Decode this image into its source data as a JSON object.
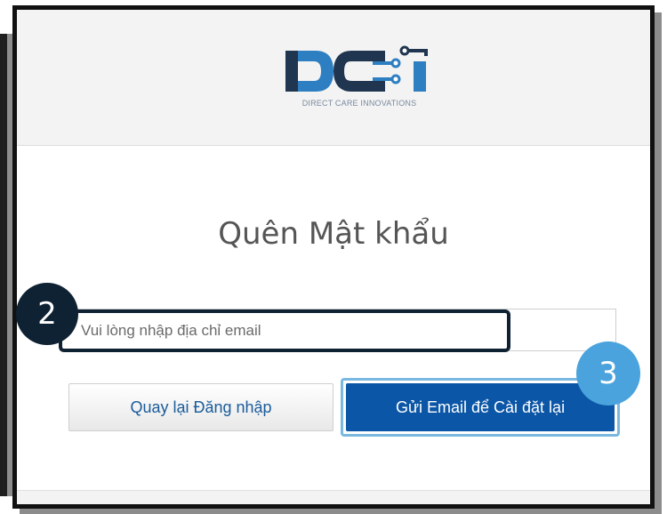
{
  "brand": {
    "logo_text": "DIRECT CARE INNOVATIONS",
    "colors": {
      "primary": "#0b56a6",
      "logo_blue": "#2e7fc2",
      "logo_dark": "#1f3550"
    }
  },
  "page": {
    "title": "Quên Mật khẩu"
  },
  "form": {
    "email_placeholder": "Vui lòng nhập địa chỉ email",
    "email_value": ""
  },
  "buttons": {
    "back_label": "Quay lại Đăng nhập",
    "send_label": "Gửi Email để Cài đặt lại"
  },
  "callouts": {
    "email_step": "2",
    "send_step": "3",
    "colors": {
      "step2": "#0f2233",
      "step3": "#4aa3dc"
    }
  }
}
